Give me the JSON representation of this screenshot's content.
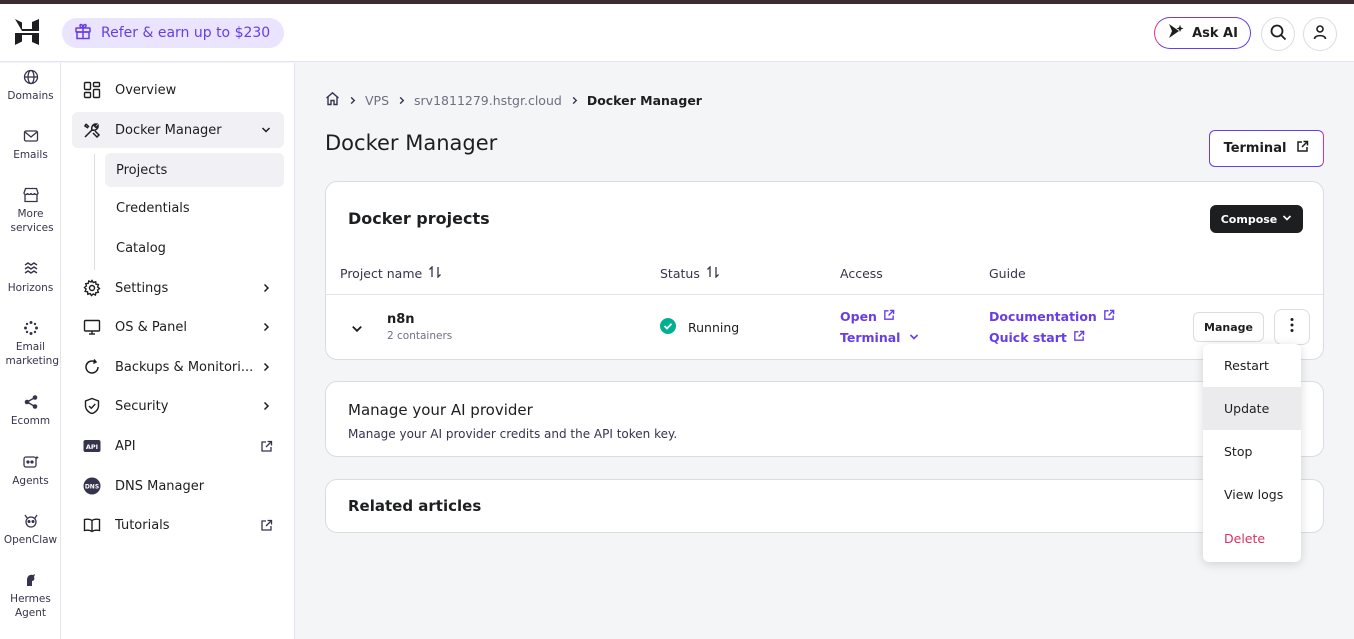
{
  "header": {
    "refer_label": "Refer & earn up to $230",
    "ask_ai_label": "Ask AI"
  },
  "rail": {
    "items": [
      {
        "label": "Domains",
        "icon": "globe-icon"
      },
      {
        "label": "Emails",
        "icon": "mail-icon"
      },
      {
        "label": "More services",
        "icon": "store-icon"
      },
      {
        "label": "Horizons",
        "icon": "horizons-icon"
      },
      {
        "label": "Email marketing",
        "icon": "email-marketing-icon"
      },
      {
        "label": "Ecomm",
        "icon": "share-nodes-icon"
      },
      {
        "label": "Agents",
        "icon": "agent-icon"
      },
      {
        "label": "OpenClaw",
        "icon": "openclaw-icon"
      },
      {
        "label": "Hermes Agent",
        "icon": "hermes-icon"
      }
    ]
  },
  "sidebar": {
    "overview": "Overview",
    "docker_manager": "Docker Manager",
    "projects": "Projects",
    "credentials": "Credentials",
    "catalog": "Catalog",
    "settings": "Settings",
    "os_panel": "OS & Panel",
    "backups": "Backups & Monitori...",
    "security": "Security",
    "api": "API",
    "dns_manager": "DNS Manager",
    "tutorials": "Tutorials"
  },
  "breadcrumb": {
    "vps": "VPS",
    "server": "srv1811279.hstgr.cloud",
    "current": "Docker Manager"
  },
  "page": {
    "title": "Docker Manager",
    "terminal_label": "Terminal"
  },
  "projects_card": {
    "title": "Docker projects",
    "compose_label": "Compose",
    "columns": {
      "name": "Project name",
      "status": "Status",
      "access": "Access",
      "guide": "Guide"
    },
    "row": {
      "name": "n8n",
      "containers": "2 containers",
      "status": "Running",
      "open": "Open",
      "terminal": "Terminal",
      "documentation": "Documentation",
      "quick_start": "Quick start",
      "manage": "Manage"
    }
  },
  "ai_card": {
    "title": "Manage your AI provider",
    "subtitle": "Manage your AI provider credits and the API token key."
  },
  "articles_card": {
    "title": "Related articles"
  },
  "menu": {
    "restart": "Restart",
    "update": "Update",
    "stop": "Stop",
    "view_logs": "View logs",
    "delete": "Delete"
  },
  "colors": {
    "accent": "#673de6",
    "running": "#00b090",
    "danger": "#d63163"
  }
}
